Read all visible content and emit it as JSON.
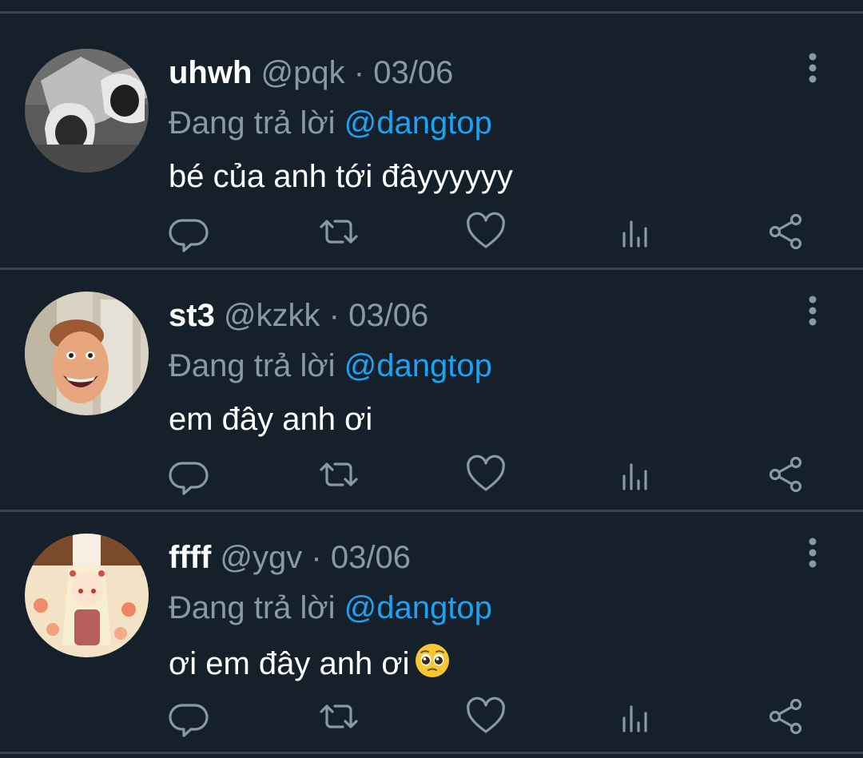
{
  "tweets": [
    {
      "name": "uhwh",
      "handle": "@pqk",
      "separator": "·",
      "date": "03/06",
      "reply_prefix": "Đang trả lời",
      "reply_to": "@dangtop",
      "text": "bé của anh tới đâyyyyyy",
      "emoji": ""
    },
    {
      "name": "st3",
      "handle": "@kzkk",
      "separator": "·",
      "date": "03/06",
      "reply_prefix": "Đang trả lời",
      "reply_to": "@dangtop",
      "text": "em đây anh ơi",
      "emoji": ""
    },
    {
      "name": "ffff",
      "handle": "@ygv",
      "separator": "·",
      "date": "03/06",
      "reply_prefix": "Đang trả lời",
      "reply_to": "@dangtop",
      "text": "ơi em đây anh ơi",
      "emoji": "pleading-face-emoji"
    }
  ],
  "icons": {
    "reply": "reply-icon",
    "retweet": "retweet-icon",
    "like": "heart-icon",
    "stats": "analytics-icon",
    "share": "share-icon",
    "more": "more-vertical-icon"
  },
  "colors": {
    "background": "#15202b",
    "divider": "#38444d",
    "secondary_text": "#8899a6",
    "link": "#1da1f2",
    "primary_text": "#ffffff"
  }
}
